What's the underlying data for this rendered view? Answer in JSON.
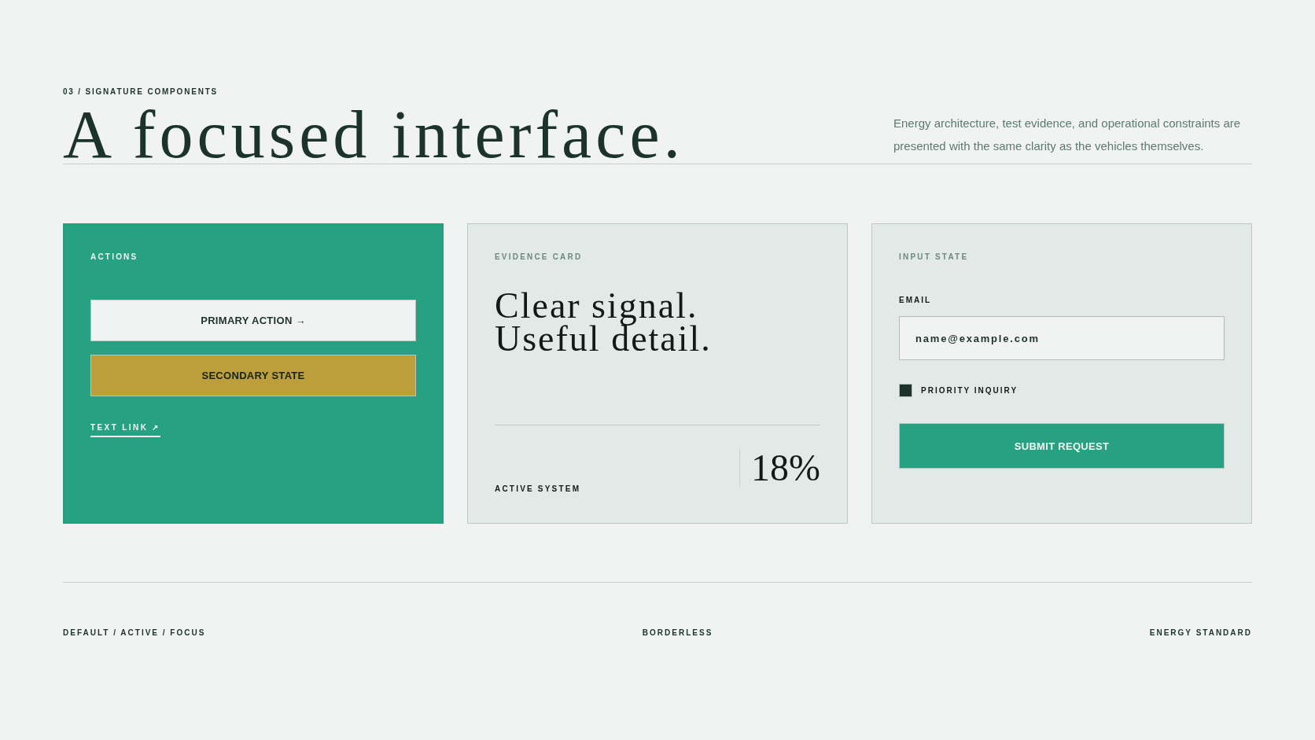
{
  "header": {
    "eyebrow": "03 / SIGNATURE COMPONENTS",
    "title": "A focused interface.",
    "description": "Energy architecture, test evidence, and operational constraints are presented with the same clarity as the vehicles themselves."
  },
  "actions_card": {
    "label": "ACTIONS",
    "primary_button": "PRIMARY ACTION →",
    "secondary_button": "SECONDARY STATE",
    "text_link": "TEXT LINK ↗"
  },
  "evidence_card": {
    "label": "EVIDENCE CARD",
    "headline": [
      "Clear signal.",
      "Useful detail."
    ],
    "caption": "ACTIVE SYSTEM",
    "metric": "18%"
  },
  "input_card": {
    "label": "INPUT STATE",
    "field_label": "EMAIL",
    "field_value": "name@example.com",
    "checkbox": {
      "label": "PRIORITY INQUIRY",
      "checked": true
    },
    "submit_button": "SUBMIT REQUEST"
  },
  "footer": [
    "DEFAULT / ACTIVE / FOCUS",
    "BORDERLESS",
    "ENERGY STANDARD"
  ]
}
